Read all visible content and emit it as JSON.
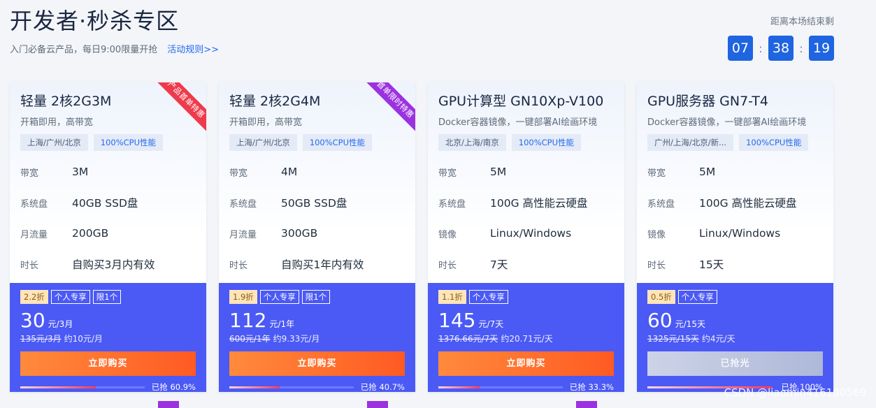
{
  "header": {
    "title": "开发者·秒杀专区",
    "subtitle": "入门必备云产品，每日9:00限量开抢",
    "rules_link": "活动规则>>"
  },
  "countdown": {
    "label": "距离本场结束剩",
    "hours": "07",
    "minutes": "38",
    "seconds": "19",
    "separator": ":"
  },
  "cards": [
    {
      "name": "轻量 2核2G3M",
      "desc": "开箱即用，高带宽",
      "ribbon": "产品首单特惠",
      "tags": [
        "上海/广州/北京",
        "100%CPU性能"
      ],
      "specs": [
        [
          "带宽",
          "3M"
        ],
        [
          "系统盘",
          "40GB SSD盘"
        ],
        [
          "月流量",
          "200GB"
        ],
        [
          "时长",
          "自购买3月内有效"
        ]
      ],
      "badges": [
        "2.2折",
        "个人专享",
        "限1个"
      ],
      "price": "30",
      "unit": "元/3月",
      "orig": "135元/3月",
      "approx": "约10元/月",
      "button": "立即购买",
      "progress_text": "已抢 60.9%",
      "progress": 60.9
    },
    {
      "name": "轻量 2核2G4M",
      "desc": "开箱即用，高带宽",
      "ribbon": "首单限时特惠",
      "tags": [
        "上海/广州/北京",
        "100%CPU性能"
      ],
      "specs": [
        [
          "带宽",
          "4M"
        ],
        [
          "系统盘",
          "50GB SSD盘"
        ],
        [
          "月流量",
          "300GB"
        ],
        [
          "时长",
          "自购买1年内有效"
        ]
      ],
      "badges": [
        "1.9折",
        "个人专享",
        "限1个"
      ],
      "price": "112",
      "unit": "元/1年",
      "orig": "600元/1年",
      "approx": "约9.33元/月",
      "button": "立即购买",
      "progress_text": "已抢 40.7%",
      "progress": 40.7
    },
    {
      "name": "GPU计算型 GN10Xp-V100",
      "desc": "Docker容器镜像，一键部署AI绘画环境",
      "ribbon": "",
      "tags": [
        "北京/上海/南京",
        "100%CPU性能"
      ],
      "specs": [
        [
          "带宽",
          "5M"
        ],
        [
          "系统盘",
          "100G 高性能云硬盘"
        ],
        [
          "镜像",
          "Linux/Windows"
        ],
        [
          "时长",
          "7天"
        ]
      ],
      "badges": [
        "1.1折",
        "个人专享"
      ],
      "price": "145",
      "unit": "元/7天",
      "orig": "1376.66元/7天",
      "approx": "约20.71元/天",
      "button": "立即购买",
      "progress_text": "已抢 33.3%",
      "progress": 33.3
    },
    {
      "name": "GPU服务器 GN7-T4",
      "desc": "Docker容器镜像，一键部署AI绘画环境",
      "ribbon": "",
      "tags": [
        "广州/上海/北京/新...",
        "100%CPU性能"
      ],
      "specs": [
        [
          "带宽",
          "5M"
        ],
        [
          "系统盘",
          "100G 高性能云硬盘"
        ],
        [
          "镜像",
          "Linux/Windows"
        ],
        [
          "时长",
          "15天"
        ]
      ],
      "badges": [
        "0.5折",
        "个人专享"
      ],
      "price": "60",
      "unit": "元/15天",
      "orig": "1325元/15天",
      "approx": "约4元/天",
      "button": "已抢光",
      "progress_text": "已抢 100%",
      "progress": 100
    }
  ],
  "watermark": "CSDN @liaomin416100569",
  "colors": {
    "accent": "#2468f2",
    "card_bottom": "#4b59f5",
    "buy_button": "#ff6a2a",
    "ribbon_red": "#ee3a4a",
    "ribbon_purple": "#9b32e0"
  }
}
